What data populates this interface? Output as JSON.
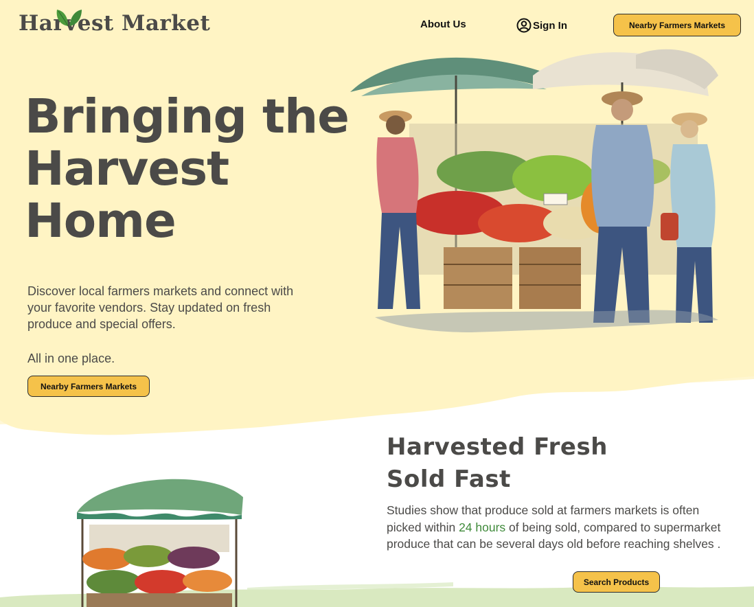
{
  "header": {
    "logo_text": "Harvest Market",
    "nav": {
      "about": "About Us",
      "sign_in": "Sign In"
    },
    "cta": "Nearby Farmers Markets"
  },
  "hero": {
    "title_lines": [
      "Bringing the",
      "Harvest",
      "Home"
    ],
    "description": "Discover local farmers markets and connect with your favorite vendors.  Stay updated on fresh produce and special offers.",
    "tagline": "All in one place.",
    "cta": "Nearby Farmers Markets",
    "image_icon": "farmers-market-watercolor-illustration"
  },
  "section": {
    "title_lines": [
      "Harvested Fresh",
      "Sold Fast"
    ],
    "text_before": "Studies show that produce sold at farmers markets is often picked within ",
    "highlight": "24 hours",
    "text_after": " of being sold, compared to supermarket produce that can be several days old before reaching shelves .",
    "cta": "Search Products",
    "image_icon": "produce-stand-watercolor-illustration"
  },
  "colors": {
    "cream": "#fff4c4",
    "button": "#f5c24a",
    "text": "#4b4a48",
    "highlight_green": "#3f8a3a",
    "brush_green": "#d9e9c0"
  }
}
